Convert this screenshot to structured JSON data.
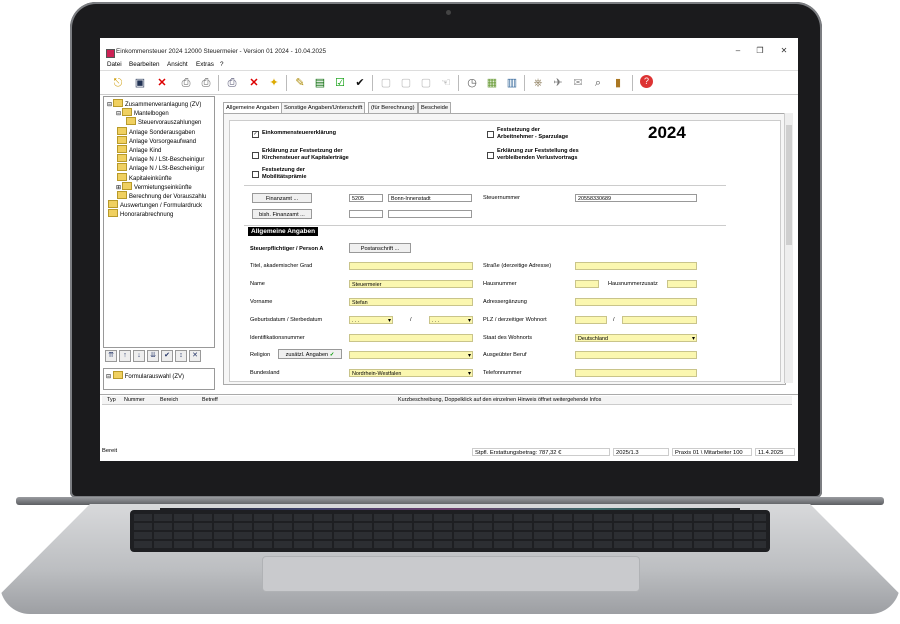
{
  "window": {
    "title": "Einkommensteuer 2024 12000 Steuermeier - Version 01 2024 - 10.04.2025",
    "minimize": "–",
    "restore": "❐",
    "close": "✕"
  },
  "menu": [
    "Datei",
    "Bearbeiten",
    "Ansicht",
    "Extras",
    "?"
  ],
  "toolbar_icons": [
    "exit-icon",
    "save-icon",
    "delete-icon",
    "print-icon",
    "printer2-icon",
    "fax-icon",
    "cancel-icon",
    "tip-icon",
    "form-icon",
    "book-icon",
    "check-icon",
    "tick-icon",
    "doc1-icon",
    "doc2-icon",
    "doc3-icon",
    "hand-icon",
    "clock-icon",
    "grid-icon",
    "chart-icon",
    "stamp-icon",
    "send-icon",
    "mail-icon",
    "preview-icon",
    "archive-icon",
    "help-icon"
  ],
  "tree": {
    "items": [
      {
        "label": "Zusammenveranlagung (ZV)",
        "level": 0,
        "prefix": "⊟"
      },
      {
        "label": "Mantelbogen",
        "level": 1,
        "prefix": "⊟"
      },
      {
        "label": "Steuervorauszahlungen",
        "level": 2,
        "prefix": ""
      },
      {
        "label": "Anlage Sonderausgaben",
        "level": 1,
        "prefix": ""
      },
      {
        "label": "Anlage Vorsorgeaufwand",
        "level": 1,
        "prefix": ""
      },
      {
        "label": "Anlage Kind",
        "level": 1,
        "prefix": ""
      },
      {
        "label": "Anlage N / LSt-Bescheinigur",
        "level": 1,
        "prefix": ""
      },
      {
        "label": "Anlage N / LSt-Bescheinigur",
        "level": 1,
        "prefix": ""
      },
      {
        "label": "Kapitaleinkünfte",
        "level": 1,
        "prefix": ""
      },
      {
        "label": "Vermietungseinkünfte",
        "level": 1,
        "prefix": "⊞"
      },
      {
        "label": "Berechnung der Vorauszahlu",
        "level": 1,
        "prefix": ""
      },
      {
        "label": "Auswertungen / Formulardruck",
        "level": 0,
        "prefix": ""
      },
      {
        "label": "Honorarabrechnung",
        "level": 0,
        "prefix": ""
      }
    ],
    "tools": [
      "⇈",
      "↑",
      "↓",
      "⇊",
      "✔",
      "↕",
      "✕"
    ],
    "bottom_item": "Formularauswahl (ZV)"
  },
  "tabs": [
    "Allgemeine Angaben",
    "Sonstige Angaben/Unterschrift",
    "(für Berechnung)",
    "Bescheide"
  ],
  "form": {
    "year": "2024",
    "checks": {
      "est": "Einkommensteuererklärung",
      "est_checked": "✓",
      "kapital_line1": "Erklärung zur Festsetzung der",
      "kapital_line2": "Kirchensteuer auf Kapitalerträge",
      "mobil_line1": "Festsetzung der",
      "mobil_line2": "Mobilitätsprämie",
      "spar_line1": "Festsetzung der",
      "spar_line2": "Arbeitnehmer - Sparzulage",
      "verlust_line1": "Erklärung zur Feststellung des",
      "verlust_line2": "verbleibenden Verlustvortrags"
    },
    "finanzamt_btn": "Finanzamt ...",
    "bish_finanzamt_btn": "bish. Finanzamt ...",
    "fa_number": "5205",
    "fa_name": "Bonn-Innenstadt",
    "steuernummer_label": "Steuernummer",
    "steuernummer": "20558330689",
    "section_title": "Allgemeine Angaben",
    "person_label": "Steuerpflichtiger / Person A",
    "postanschrift_btn": "Postanschrift ...",
    "left": {
      "titel": "Titel, akademischer Grad",
      "name": "Name",
      "name_value": "Steuermeier",
      "vorname": "Vorname",
      "vorname_value": "Stefan",
      "geburt": "Geburtsdatum / Sterbedatum",
      "geburt1": ". . .",
      "geburt2": ". . .",
      "slash": "/",
      "ident": "Identifikationsnummer",
      "religion": "Religion",
      "zusaetzl_btn": "zusätzl. Angaben",
      "zusaetzl_check": "✓",
      "bundesland": "Bundesland",
      "bundesland_value": "Nordrhein-Westfalen"
    },
    "right": {
      "strasse": "Straße (derzeitige Adresse)",
      "hausnummer": "Hausnummer",
      "hausnummerzusatz": "Hausnummerzusatz",
      "adress": "Adressergänzung",
      "plz": "PLZ / derzeitiger Wohnort",
      "slash": "/",
      "staat": "Staat des Wohnorts",
      "staat_value": "Deutschland",
      "beruf": "Ausgeübter Beruf",
      "telefon": "Telefonnummer"
    }
  },
  "hints": {
    "columns": [
      "Typ",
      "Nummer",
      "Bereich",
      "Betreff"
    ],
    "description": "Kurzbeschreibung, Doppelklick auf den einzelnen Hinweis öffnet weitergehende Infos"
  },
  "status": {
    "ready": "Bereit",
    "erstattung": "Stpfl. Erstattungsbetrag: 787,32 €",
    "version": "2025/1.3",
    "praxis": "Praxis 01 \\ Mitarbeiter 100",
    "date": "11.4.2025"
  }
}
